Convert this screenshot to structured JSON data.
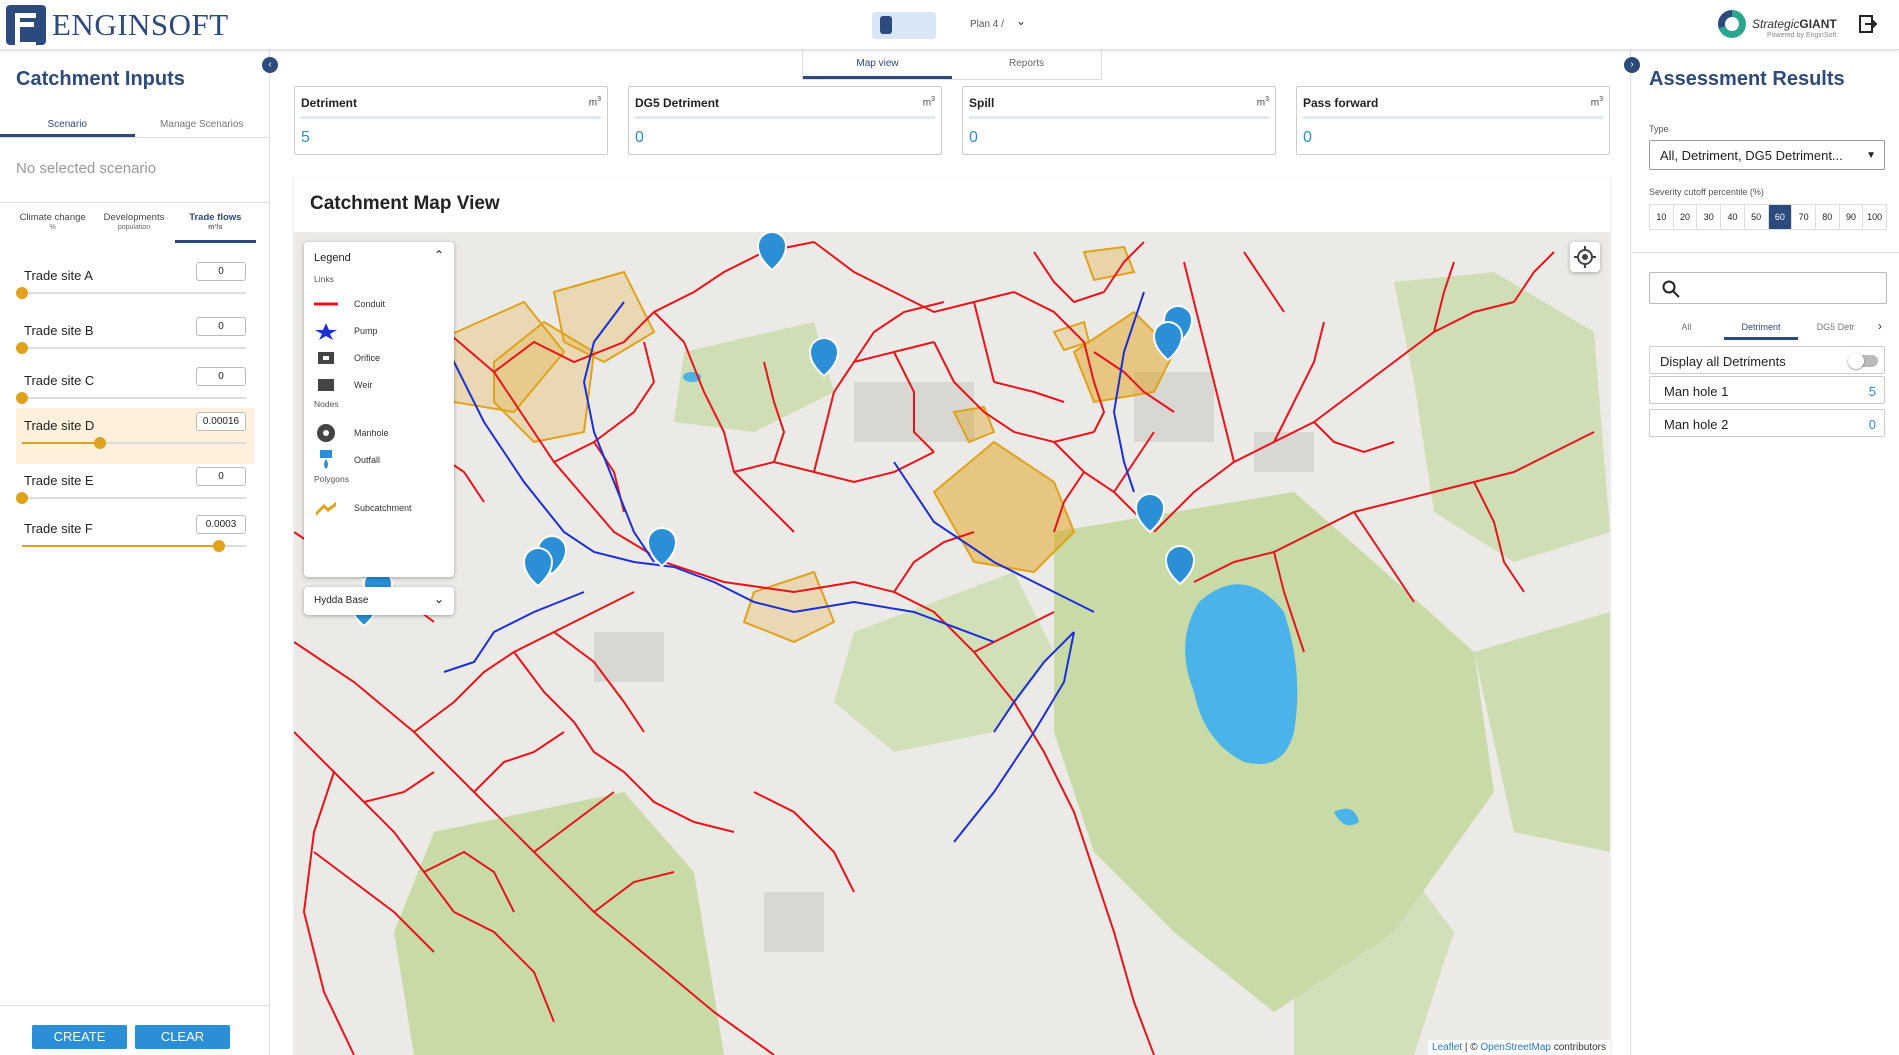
{
  "app": {
    "brand": "ENGINSOFT",
    "plan_label": "Plan 4 /",
    "partner_brand_prefix": "Strategic",
    "partner_brand_bold": "GIANT",
    "partner_sub": "Powered by EnginSoft"
  },
  "left": {
    "title": "Catchment Inputs",
    "tabs": [
      {
        "label": "Scenario",
        "active": true
      },
      {
        "label": "Manage Scenarios",
        "active": false
      }
    ],
    "no_scenario": "No selected scenario",
    "subtabs": [
      {
        "label": "Climate change",
        "unit": "%",
        "active": false
      },
      {
        "label": "Developments",
        "unit": "population",
        "active": false
      },
      {
        "label": "Trade flows",
        "unit": "m³/s",
        "active": true
      }
    ],
    "trade_sites": [
      {
        "name": "Trade site A",
        "value": "0",
        "fraction": 0.0,
        "highlight": false
      },
      {
        "name": "Trade site B",
        "value": "0",
        "fraction": 0.0,
        "highlight": false
      },
      {
        "name": "Trade site C",
        "value": "0",
        "fraction": 0.0,
        "highlight": false
      },
      {
        "name": "Trade site D",
        "value": "0.00016",
        "fraction": 0.35,
        "highlight": true
      },
      {
        "name": "Trade site E",
        "value": "0",
        "fraction": 0.0,
        "highlight": false
      },
      {
        "name": "Trade site F",
        "value": "0.0003",
        "fraction": 0.88,
        "highlight": false
      }
    ],
    "create_label": "CREATE",
    "clear_label": "CLEAR"
  },
  "center": {
    "view_tabs": [
      {
        "label": "Map view",
        "active": true
      },
      {
        "label": "Reports",
        "active": false
      }
    ],
    "cards": [
      {
        "title": "Detriment",
        "unit": "m",
        "unit_sup": "3",
        "value": "5"
      },
      {
        "title": "DG5 Detriment",
        "unit": "m",
        "unit_sup": "3",
        "value": "0"
      },
      {
        "title": "Spill",
        "unit": "m",
        "unit_sup": "3",
        "value": "0"
      },
      {
        "title": "Pass forward",
        "unit": "m",
        "unit_sup": "3",
        "value": "0"
      }
    ],
    "map_title": "Catchment Map View",
    "legend": {
      "title": "Legend",
      "sections": {
        "links": "Links",
        "nodes": "Nodes",
        "polygons": "Polygons"
      },
      "items": {
        "conduit": "Conduit",
        "pump": "Pump",
        "orifice": "Orifice",
        "weir": "Weir",
        "manhole": "Manhole",
        "outfall": "Outfall",
        "subcatchment": "Subcatchment"
      }
    },
    "basemap": "Hydda Base",
    "attribution": {
      "leaflet": "Leaflet",
      "sep": " | © ",
      "osm": "OpenStreetMap",
      "suffix": " contributors"
    },
    "colors": {
      "conduit": "#e8141c",
      "pump": "#1a2fd6",
      "subcatchment": "#e0a21c",
      "water": "#4ab3ea",
      "park": "#c8dba7"
    }
  },
  "right": {
    "title": "Assessment Results",
    "type_label": "Type",
    "type_value": "All, Detriment, DG5 Detriment...",
    "severity_label": "Severity cutoff percentile (%)",
    "severity_options": [
      "10",
      "20",
      "30",
      "40",
      "50",
      "60",
      "70",
      "80",
      "90",
      "100"
    ],
    "severity_selected": "60",
    "tabs": [
      {
        "label": "All",
        "active": false
      },
      {
        "label": "Detriment",
        "active": true
      },
      {
        "label": "DG5 Detr",
        "active": false
      }
    ],
    "display_all": "Display all Detriments",
    "results": [
      {
        "name": "Man hole 1",
        "value": "5"
      },
      {
        "name": "Man hole 2",
        "value": "0"
      }
    ]
  }
}
